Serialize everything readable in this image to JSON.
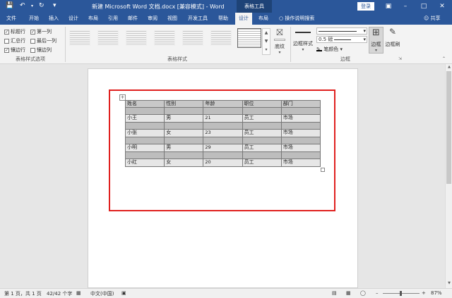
{
  "titlebar": {
    "title": "新建 Microsoft Word 文档.docx [兼容模式] - Word",
    "context_tool": "表格工具",
    "login": "登录",
    "save_icon": "save-icon",
    "undo_icon": "undo-icon",
    "redo_icon": "redo-icon",
    "customize_icon": "customize-qat-icon",
    "ribbon_display_icon": "ribbon-display-icon",
    "min_icon": "minimize-icon",
    "max_icon": "maximize-icon",
    "close_icon": "close-icon"
  },
  "tabs": [
    "文件",
    "开始",
    "插入",
    "设计",
    "布局",
    "引用",
    "邮件",
    "审阅",
    "视图",
    "开发工具",
    "帮助",
    "设计",
    "布局"
  ],
  "active_tab": "设计",
  "tell_me": "操作说明搜索",
  "share": "共享",
  "ribbon": {
    "options": [
      {
        "label": "标题行",
        "checked": true
      },
      {
        "label": "第一列",
        "checked": true
      },
      {
        "label": "汇总行",
        "checked": false
      },
      {
        "label": "最后一列",
        "checked": false
      },
      {
        "label": "镶边行",
        "checked": true
      },
      {
        "label": "镶边列",
        "checked": false
      }
    ],
    "options_group": "表格样式选项",
    "styles_group": "表格样式",
    "shading": "底纹",
    "border_styles": "边框样式",
    "line_weight": "0.5 磅",
    "pen_color": "笔颜色",
    "borders": "边框",
    "border_painter": "边框刷",
    "borders_group": "边框"
  },
  "table": {
    "headers": [
      "姓名",
      "性别",
      "年龄",
      "职位",
      "部门"
    ],
    "rows": [
      [
        "小王",
        "男",
        "21",
        "员工",
        "市场"
      ],
      [
        "小张",
        "女",
        "23",
        "员工",
        "市场"
      ],
      [
        "小明",
        "男",
        "29",
        "员工",
        "市场"
      ],
      [
        "小红",
        "女",
        "20",
        "员工",
        "市场"
      ]
    ]
  },
  "status": {
    "page": "第 1 页，共 1 页",
    "words": "42/42 个字",
    "lang": "中文(中国)",
    "zoom": "87%"
  },
  "colors": {
    "title_blue": "#2b579a",
    "highlight_red": "#e0201e"
  }
}
